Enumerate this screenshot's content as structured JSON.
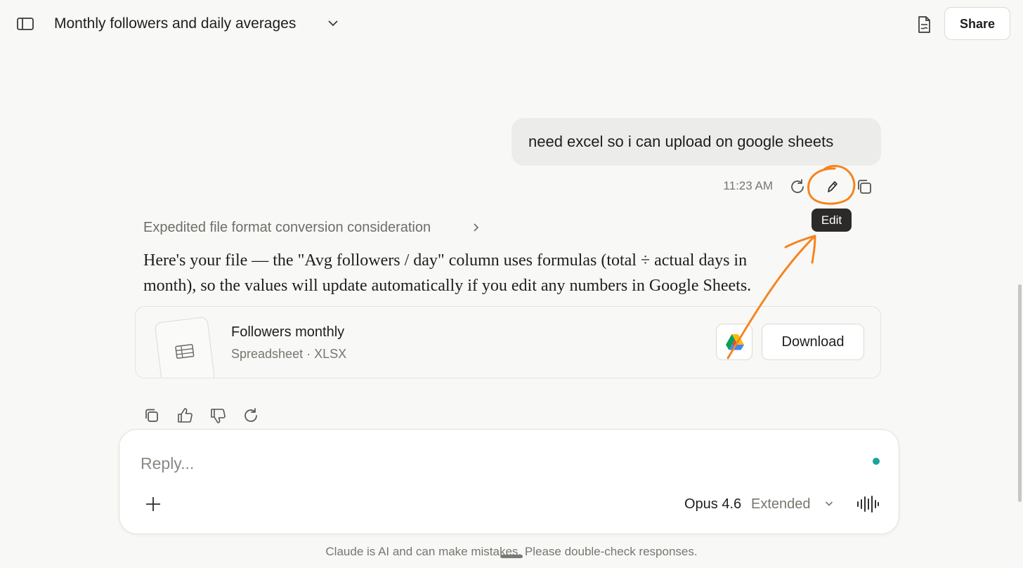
{
  "header": {
    "title": "Monthly followers and daily averages",
    "share_label": "Share",
    "icons": [
      "sidebar-toggle-icon",
      "chevron-down-icon",
      "document-icon"
    ]
  },
  "user_message": {
    "text": "need excel so i can upload on google sheets",
    "timestamp": "11:23 AM",
    "actions": [
      "retry-icon",
      "edit-icon",
      "copy-icon"
    ],
    "tooltip": "Edit"
  },
  "assistant": {
    "thinking_label": "Expedited file format conversion consideration",
    "answer_line1": "Here's your file — the \"Avg followers / day\" column uses formulas (total ÷ actual days in",
    "answer_line2": "month), so the values will update automatically if you edit any numbers in Google Sheets.",
    "file": {
      "name": "Followers monthly",
      "meta": "Spreadsheet · XLSX",
      "download_label": "Download"
    },
    "actions": [
      "copy-icon",
      "thumbs-up-icon",
      "thumbs-down-icon",
      "retry-icon"
    ]
  },
  "composer": {
    "placeholder": "Reply...",
    "model": "Opus 4.6",
    "mode": "Extended"
  },
  "disclaimer": "Claude is AI and can make mistakes. Please double-check responses.",
  "colors": {
    "background": "#f8f8f6",
    "bubble": "#ececea",
    "annotation": "#f5841f",
    "status_dot": "#1aa39a"
  }
}
